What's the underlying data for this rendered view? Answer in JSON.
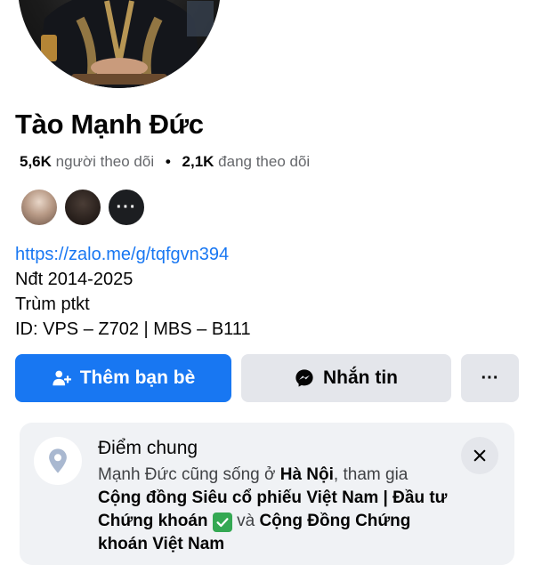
{
  "profile": {
    "name": "Tào Mạnh Đức",
    "followers_count": "5,6K",
    "followers_label": "người theo dõi",
    "following_count": "2,1K",
    "following_label": "đang theo dõi",
    "separator": "•",
    "more_friends": "···"
  },
  "bio": {
    "link": "https://zalo.me/g/tqfgvn394",
    "line1": "Nđt 2014-2025",
    "line2": "Trùm ptkt",
    "line3": "ID: VPS – Z702 | MBS – B111"
  },
  "actions": {
    "add_friend": "Thêm bạn bè",
    "message": "Nhắn tin",
    "more": "···"
  },
  "mutual": {
    "title": "Điểm chung",
    "text_1": "Mạnh Đức cũng sống ở ",
    "city": "Hà Nội",
    "text_2": ", tham gia ",
    "group_1": "Cộng đồng Siêu cổ phiếu Việt Nam | Đầu tư Chứng khoán",
    "text_3": " và ",
    "group_2": "Cộng Đồng Chứng khoán Việt Nam"
  },
  "colors": {
    "accent": "#1877f2",
    "button_secondary": "#e4e6eb",
    "card_bg": "#f0f2f5",
    "muted_text": "#65676b"
  },
  "icons": {
    "add_friend": "person-plus-icon",
    "message": "messenger-icon",
    "location": "location-pin-icon",
    "close": "close-icon",
    "check": "check-mark-icon"
  }
}
